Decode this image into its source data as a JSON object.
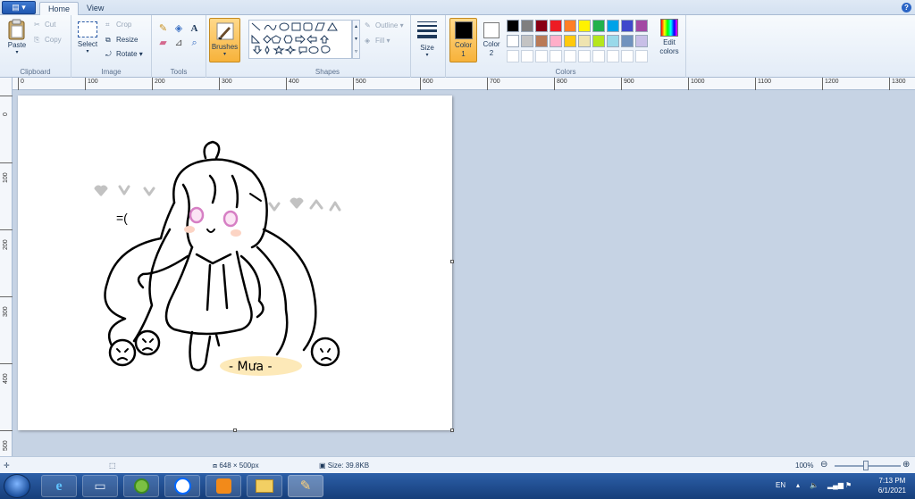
{
  "app": {
    "menu_label": "▤ ▾",
    "help": "?"
  },
  "tabs": [
    {
      "label": "Home"
    },
    {
      "label": "View"
    }
  ],
  "ribbon": {
    "clipboard": {
      "label": "Clipboard",
      "paste": "Paste",
      "cut": "Cut",
      "copy": "Copy"
    },
    "image": {
      "label": "Image",
      "select": "Select",
      "crop": "Crop",
      "resize": "Resize",
      "rotate": "Rotate"
    },
    "tools": {
      "label": "Tools"
    },
    "brushes": {
      "label": "Brushes"
    },
    "shapes": {
      "label": "Shapes",
      "outline": "Outline",
      "fill": "Fill"
    },
    "size": {
      "label": "Size"
    },
    "colors": {
      "label": "Colors",
      "color1": "Color 1",
      "color2": "Color 2",
      "edit": "Edit colors",
      "color1_value": "#000000",
      "color2_value": "#ffffff",
      "palette_row1": [
        "#000000",
        "#7f7f7f",
        "#880015",
        "#ed1c24",
        "#ff7f27",
        "#fff200",
        "#22b14c",
        "#00a2e8",
        "#3f48cc",
        "#a349a4"
      ],
      "palette_row2": [
        "#ffffff",
        "#c3c3c3",
        "#b97a57",
        "#ffaec9",
        "#ffc90e",
        "#efe4b0",
        "#b5e61d",
        "#99d9ea",
        "#7092be",
        "#c8bfe7"
      ]
    }
  },
  "ruler": {
    "h_labels": [
      "0",
      "100",
      "200",
      "300",
      "400",
      "500",
      "600",
      "700",
      "800",
      "900",
      "1000",
      "1100",
      "1200",
      "1300"
    ],
    "v_labels": [
      "0",
      "100",
      "200",
      "300",
      "400",
      "500"
    ]
  },
  "drawing": {
    "signature": "- Mưa -"
  },
  "status": {
    "dimensions": "648 × 500px",
    "size": "Size: 39.8KB",
    "zoom": "100%"
  },
  "tray": {
    "lang": "EN",
    "time": "7:13 PM",
    "date": "6/1/2021"
  }
}
